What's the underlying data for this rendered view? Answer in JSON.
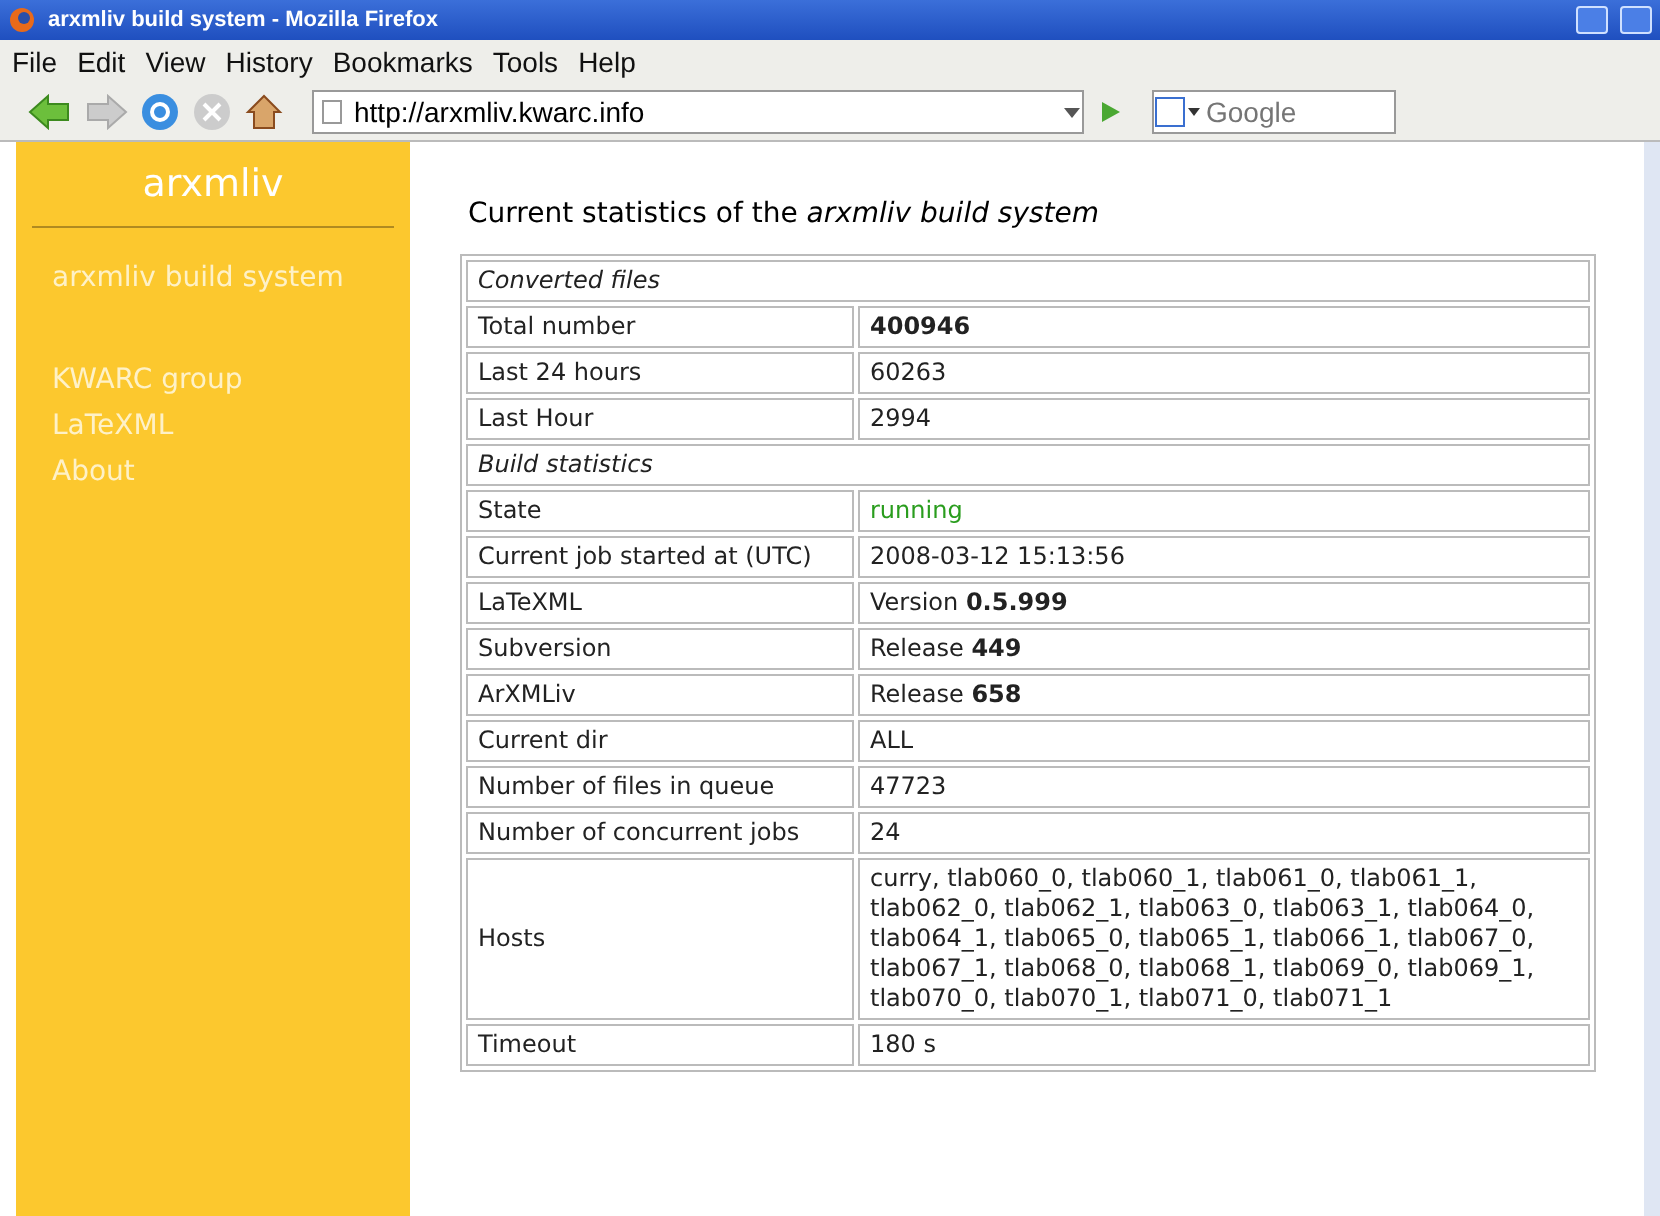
{
  "window": {
    "title": "arxmliv build system - Mozilla Firefox"
  },
  "menu": [
    "File",
    "Edit",
    "View",
    "History",
    "Bookmarks",
    "Tools",
    "Help"
  ],
  "address_bar": {
    "value": "http://arxmliv.kwarc.info"
  },
  "search": {
    "placeholder": "Google"
  },
  "sidebar": {
    "title": "arxmliv",
    "groups": [
      [
        "arxmliv build system"
      ],
      [
        "KWARC group",
        "LaTeXML",
        "About"
      ]
    ]
  },
  "heading": "Current statistics of the *arxmliv build system*",
  "table": {
    "rows": [
      {
        "kind": "section",
        "label": "Converted files"
      },
      {
        "kind": "row",
        "label": "Total number",
        "value": "**400946**"
      },
      {
        "kind": "row",
        "label": "Last 24 hours",
        "value": "60263"
      },
      {
        "kind": "row",
        "label": "Last Hour",
        "value": "2994"
      },
      {
        "kind": "section",
        "label": "Build statistics"
      },
      {
        "kind": "status",
        "label": "State",
        "value": "running"
      },
      {
        "kind": "row",
        "label": "Current job started at (UTC)",
        "value": "2008-03-12 15:13:56"
      },
      {
        "kind": "row",
        "label": "LaTeXML",
        "value": "Version **0.5.999**"
      },
      {
        "kind": "row",
        "label": "Subversion",
        "value": "Release **449**"
      },
      {
        "kind": "row",
        "label": "ArXMLiv",
        "value": "Release **658**"
      },
      {
        "kind": "row",
        "label": "Current dir",
        "value": "ALL"
      },
      {
        "kind": "row",
        "label": "Number of files in queue",
        "value": "47723"
      },
      {
        "kind": "row",
        "label": "Number of concurrent jobs",
        "value": "24"
      },
      {
        "kind": "row",
        "label": "Hosts",
        "value": "curry, tlab060_0, tlab060_1, tlab061_0, tlab061_1, tlab062_0, tlab062_1, tlab063_0, tlab063_1, tlab064_0, tlab064_1, tlab065_0, tlab065_1, tlab066_1, tlab067_0, tlab067_1, tlab068_0, tlab068_1, tlab069_0, tlab069_1, tlab070_0, tlab070_1, tlab071_0, tlab071_1"
      },
      {
        "kind": "row",
        "label": "Timeout",
        "value": "180 s"
      }
    ]
  }
}
